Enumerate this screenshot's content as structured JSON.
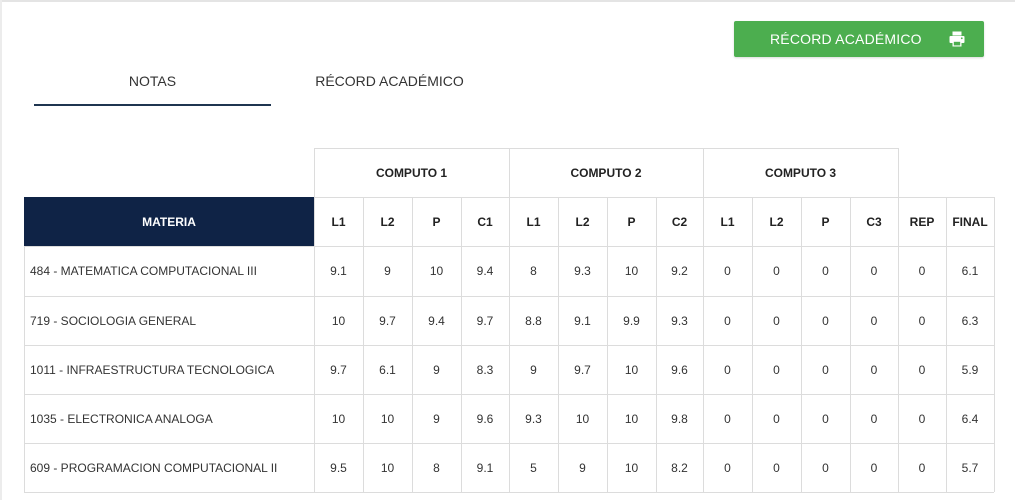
{
  "actions": {
    "print_button_label": "RÉCORD ACADÉMICO",
    "print_icon": "printer-icon"
  },
  "tabs": [
    {
      "label": "NOTAS",
      "active": true
    },
    {
      "label": "RÉCORD ACADÉMICO",
      "active": false
    }
  ],
  "table": {
    "groups": [
      "COMPUTO 1",
      "COMPUTO 2",
      "COMPUTO 3"
    ],
    "materia_header": "MATERIA",
    "columns": [
      "L1",
      "L2",
      "P",
      "C1",
      "L1",
      "L2",
      "P",
      "C2",
      "L1",
      "L2",
      "P",
      "C3",
      "REP",
      "FINAL"
    ],
    "rows": [
      {
        "materia": "484 - MATEMATICA COMPUTACIONAL III",
        "values": [
          "9.1",
          "9",
          "10",
          "9.4",
          "8",
          "9.3",
          "10",
          "9.2",
          "0",
          "0",
          "0",
          "0",
          "0",
          "6.1"
        ]
      },
      {
        "materia": "719 - SOCIOLOGIA GENERAL",
        "values": [
          "10",
          "9.7",
          "9.4",
          "9.7",
          "8.8",
          "9.1",
          "9.9",
          "9.3",
          "0",
          "0",
          "0",
          "0",
          "0",
          "6.3"
        ]
      },
      {
        "materia": "1011 - INFRAESTRUCTURA TECNOLOGICA",
        "values": [
          "9.7",
          "6.1",
          "9",
          "8.3",
          "9",
          "9.7",
          "10",
          "9.6",
          "0",
          "0",
          "0",
          "0",
          "0",
          "5.9"
        ]
      },
      {
        "materia": "1035 - ELECTRONICA ANALOGA",
        "values": [
          "10",
          "10",
          "9",
          "9.6",
          "9.3",
          "10",
          "10",
          "9.8",
          "0",
          "0",
          "0",
          "0",
          "0",
          "6.4"
        ]
      },
      {
        "materia": "609 - PROGRAMACION COMPUTACIONAL II",
        "values": [
          "9.5",
          "10",
          "8",
          "9.1",
          "5",
          "9",
          "10",
          "8.2",
          "0",
          "0",
          "0",
          "0",
          "0",
          "5.7"
        ]
      }
    ]
  },
  "colors": {
    "accent_green": "#4cae4f",
    "materia_header_bg": "#0f2346",
    "tab_underline": "#1f3550"
  }
}
